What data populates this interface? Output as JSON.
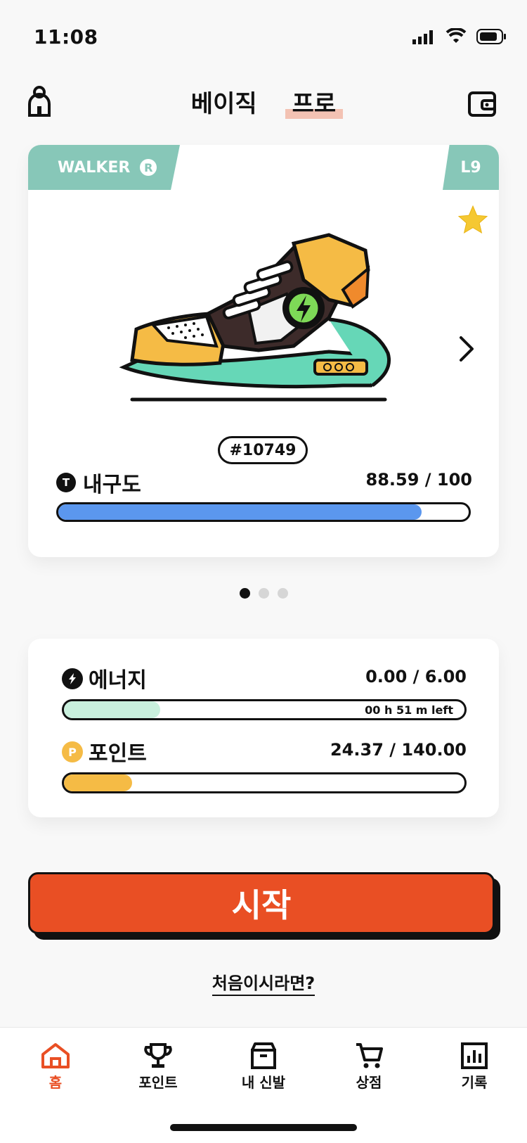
{
  "status_bar": {
    "time": "11:08"
  },
  "header": {
    "tabs": [
      {
        "label": "베이직"
      },
      {
        "label": "프로"
      }
    ]
  },
  "sneaker_card": {
    "type_label": "WALKER",
    "rarity_badge": "R",
    "level": "L9",
    "id": "#10749",
    "durability": {
      "label": "내구도",
      "value_text": "88.59 / 100",
      "current": 88.59,
      "max": 100
    }
  },
  "pager": {
    "pages": 3,
    "active": 0
  },
  "stats": {
    "energy": {
      "label": "에너지",
      "value_text": "0.00 / 6.00",
      "timer_text": "00 h 51 m left",
      "fill_fraction": 0.24
    },
    "points": {
      "label": "포인트",
      "value_text": "24.37 / 140.00",
      "icon_text": "P",
      "fill_fraction": 0.17
    }
  },
  "actions": {
    "start_label": "시작",
    "first_time_label": "처음이시라면?"
  },
  "bottom_nav": {
    "items": [
      {
        "label": "홈",
        "icon": "home-icon",
        "active": true
      },
      {
        "label": "포인트",
        "icon": "trophy-icon"
      },
      {
        "label": "내 신발",
        "icon": "box-icon"
      },
      {
        "label": "상점",
        "icon": "cart-icon"
      },
      {
        "label": "기록",
        "icon": "chart-icon"
      }
    ]
  },
  "colors": {
    "accent": "#e94f24",
    "teal": "#87c7b8",
    "blue": "#5b97ee",
    "yellow": "#f5bb45",
    "mint": "#c9f0dd"
  }
}
